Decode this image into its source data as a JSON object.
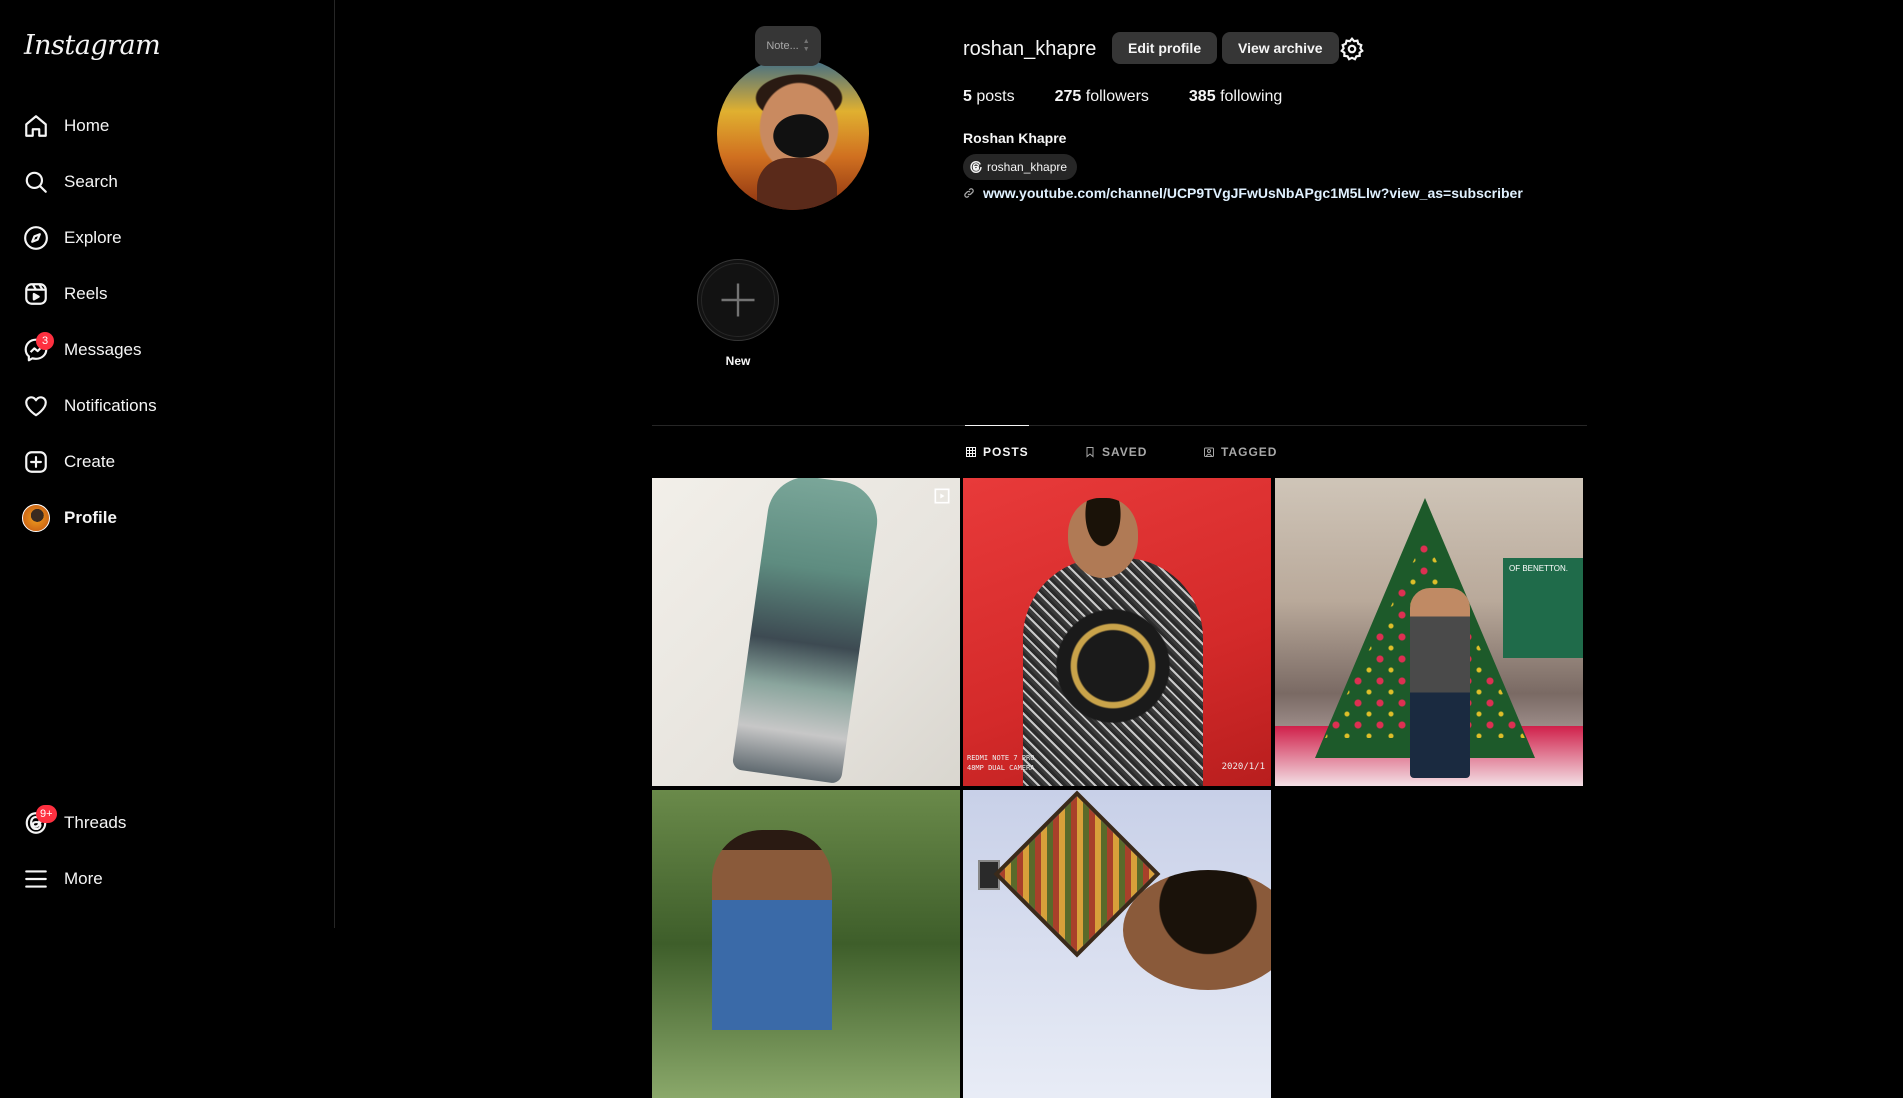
{
  "app": {
    "logo": "Instagram"
  },
  "sidebar": {
    "items": [
      {
        "label": "Home",
        "icon": "home-icon"
      },
      {
        "label": "Search",
        "icon": "search-icon"
      },
      {
        "label": "Explore",
        "icon": "compass-icon"
      },
      {
        "label": "Reels",
        "icon": "reels-icon"
      },
      {
        "label": "Messages",
        "icon": "messenger-icon",
        "badge": "3"
      },
      {
        "label": "Notifications",
        "icon": "heart-icon"
      },
      {
        "label": "Create",
        "icon": "plus-square-icon"
      },
      {
        "label": "Profile",
        "icon": "avatar"
      }
    ],
    "bottom": [
      {
        "label": "Threads",
        "icon": "threads-icon",
        "badge": "9+"
      },
      {
        "label": "More",
        "icon": "hamburger-icon"
      }
    ]
  },
  "profile": {
    "note_placeholder": "Note...",
    "username": "roshan_khapre",
    "edit_label": "Edit profile",
    "archive_label": "View archive",
    "stats": {
      "posts_count": "5",
      "posts_label": "posts",
      "followers_count": "275",
      "followers_label": "followers",
      "following_count": "385",
      "following_label": "following"
    },
    "full_name": "Roshan Khapre",
    "threads_handle": "roshan_khapre",
    "link": "www.youtube.com/channel/UCP9TVgJFwUsNbAPgc1M5Llw?view_as=subscriber"
  },
  "highlights": {
    "new_label": "New"
  },
  "tabs": [
    {
      "label": "POSTS",
      "icon": "grid-icon",
      "active": true
    },
    {
      "label": "SAVED",
      "icon": "bookmark-icon",
      "active": false
    },
    {
      "label": "TAGGED",
      "icon": "tagged-icon",
      "active": false
    }
  ],
  "posts": [
    {
      "kind": "reel",
      "caption": ""
    },
    {
      "kind": "photo",
      "caption_left_1": "REDMI NOTE 7 PRO",
      "caption_left_2": "48MP DUAL CAMERA",
      "caption_right": "2020/1/1"
    },
    {
      "kind": "photo",
      "store_sign": "OF BENETTON."
    },
    {
      "kind": "photo"
    },
    {
      "kind": "photo"
    }
  ],
  "colors": {
    "background": "#000000",
    "badge": "#ff3040",
    "button": "#363636",
    "link": "#e0f1ff"
  }
}
